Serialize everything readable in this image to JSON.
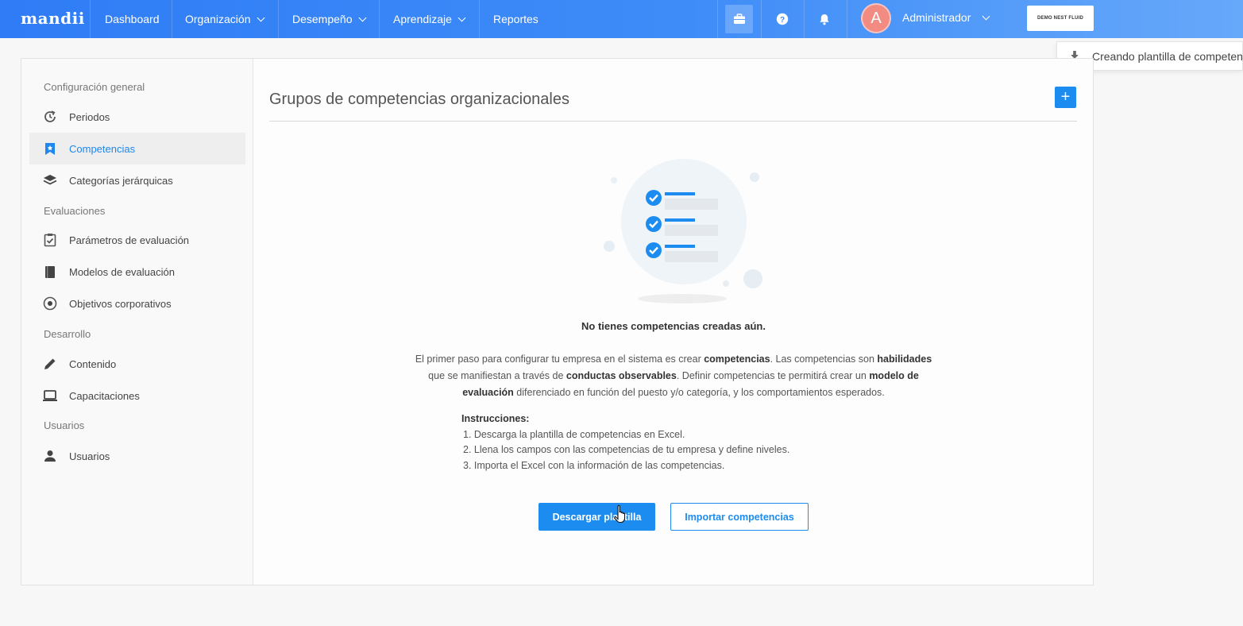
{
  "header": {
    "logo": "mandii",
    "nav": [
      {
        "label": "Dashboard",
        "has_dropdown": false
      },
      {
        "label": "Organización",
        "has_dropdown": true
      },
      {
        "label": "Desempeño",
        "has_dropdown": true
      },
      {
        "label": "Aprendizaje",
        "has_dropdown": true
      },
      {
        "label": "Reportes",
        "has_dropdown": false
      }
    ],
    "icons": [
      "briefcase-icon",
      "help-icon",
      "bell-icon"
    ],
    "avatar_initial": "A",
    "user_name": "Administrador",
    "brand_box": "DEMO NEST FLUID",
    "gradient_start": "#2f7cf6",
    "gradient_end": "#66a8fa"
  },
  "toast": {
    "icon": "download-icon",
    "text": "Creando plantilla de competencias"
  },
  "sidebar": {
    "sections": [
      {
        "label": "Configuración general",
        "items": [
          {
            "label": "Periodos",
            "icon": "history-icon"
          },
          {
            "label": "Competencias",
            "icon": "bookmark-star-icon",
            "active": true
          },
          {
            "label": "Categorías jerárquicas",
            "icon": "layers-icon"
          }
        ]
      },
      {
        "label": "Evaluaciones",
        "items": [
          {
            "label": "Parámetros de evaluación",
            "icon": "clipboard-check-icon"
          },
          {
            "label": "Modelos de evaluación",
            "icon": "book-icon"
          },
          {
            "label": "Objetivos corporativos",
            "icon": "target-icon"
          }
        ]
      },
      {
        "label": "Desarrollo",
        "items": [
          {
            "label": "Contenido",
            "icon": "pencil-icon"
          },
          {
            "label": "Capacitaciones",
            "icon": "laptop-icon"
          }
        ]
      },
      {
        "label": "Usuarios",
        "items": [
          {
            "label": "Usuarios",
            "icon": "user-icon"
          }
        ]
      }
    ],
    "active_color": "#1f87f0"
  },
  "main": {
    "title": "Grupos de competencias organizacionales",
    "add_button": "+",
    "empty_title": "No tienes competencias creadas aún.",
    "description": {
      "p1": "El primer paso para configurar tu empresa en el sistema es crear ",
      "b1": "competencias",
      "p2": ". Las competencias son ",
      "b2": "habilidades",
      "p3": " que se manifiestan a través de ",
      "b3": "conductas observables",
      "p4": ". Definir competencias te permitirá crear un ",
      "b4": "modelo de evaluación",
      "p5": " diferenciado en función del puesto y/o categoría, y los comportamientos esperados."
    },
    "instructions": {
      "heading": "Instrucciones:",
      "steps": [
        "1. Descarga la plantilla de competencias en Excel.",
        "2. Llena los campos con las competencias de tu empresa y define niveles.",
        "3. Importa el Excel con la información de las competencias."
      ]
    },
    "download_button": "Descargar plantilla",
    "import_button": "Importar competencias",
    "accent_color": "#1d8cf0"
  }
}
